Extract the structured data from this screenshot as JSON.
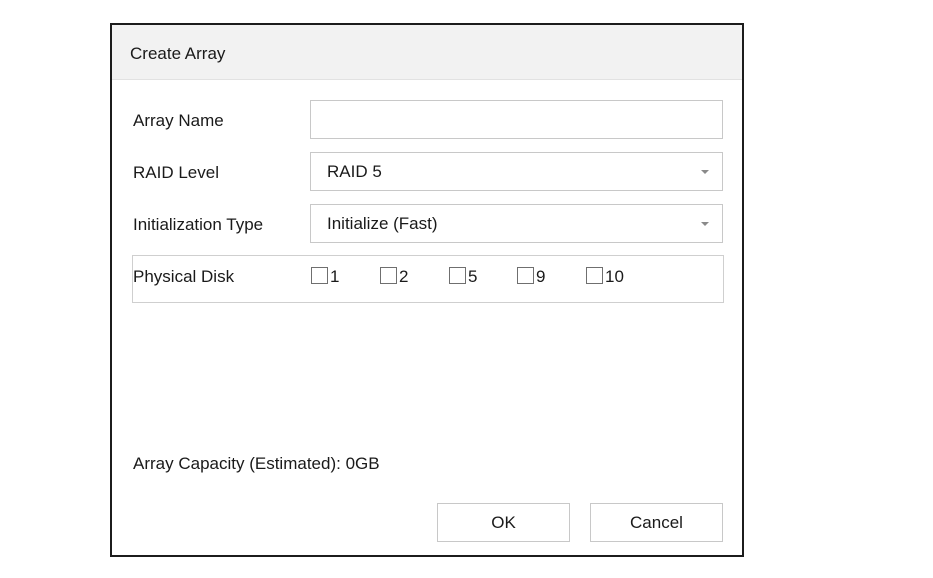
{
  "dialog": {
    "title": "Create Array",
    "array_name": {
      "label": "Array Name",
      "value": ""
    },
    "raid_level": {
      "label": "RAID Level",
      "value": "RAID 5"
    },
    "init_type": {
      "label": "Initialization Type",
      "value": "Initialize (Fast)"
    },
    "physical_disk": {
      "label": "Physical Disk",
      "disks": [
        {
          "label": "1",
          "checked": false
        },
        {
          "label": "2",
          "checked": false
        },
        {
          "label": "5",
          "checked": false
        },
        {
          "label": "9",
          "checked": false
        },
        {
          "label": "10",
          "checked": false
        }
      ]
    },
    "capacity": {
      "label": "Array Capacity (Estimated):",
      "value": "0GB"
    },
    "buttons": {
      "ok": "OK",
      "cancel": "Cancel"
    }
  },
  "icons": {
    "dropdown": "chevron-down-icon",
    "checkbox": "checkbox-icon"
  },
  "colors": {
    "header_bg": "#f2f2f2",
    "border": "#c8c8c8",
    "dialog_border": "#1c1c1c"
  }
}
